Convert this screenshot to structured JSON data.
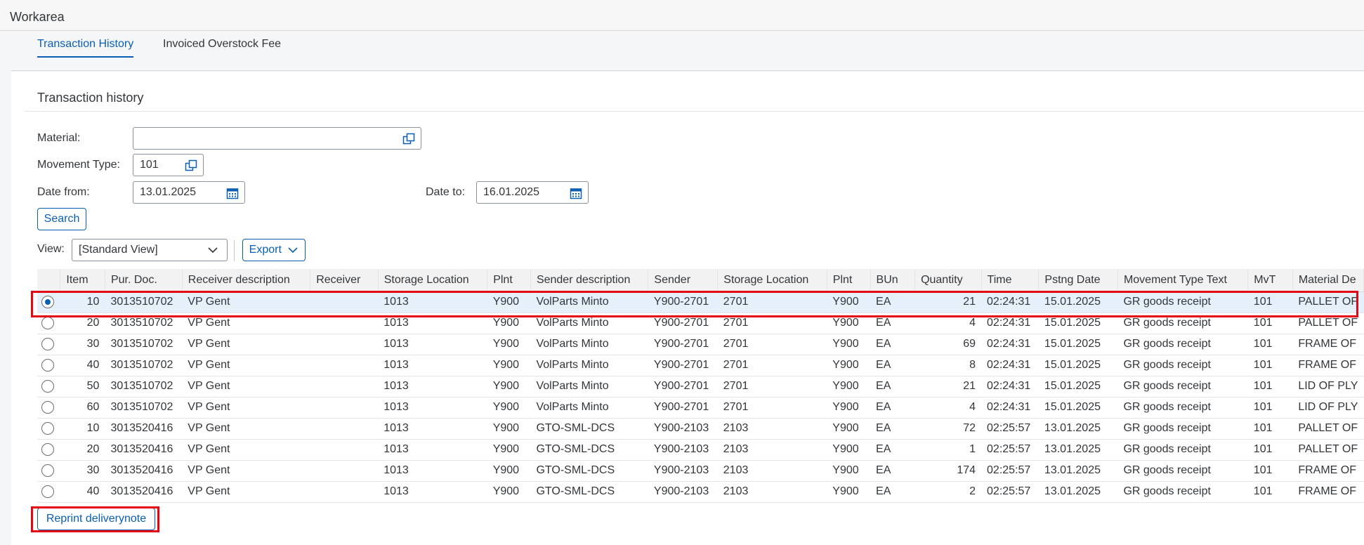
{
  "window": {
    "title": "Workarea"
  },
  "tabs": [
    {
      "label": "Transaction History",
      "active": true
    },
    {
      "label": "Invoiced Overstock Fee",
      "active": false
    }
  ],
  "section": {
    "title": "Transaction history"
  },
  "form": {
    "material": {
      "label": "Material:",
      "value": ""
    },
    "movement_type": {
      "label": "Movement Type:",
      "value": "101"
    },
    "date_from": {
      "label": "Date from:",
      "value": "13.01.2025"
    },
    "date_to": {
      "label": "Date to:",
      "value": "16.01.2025"
    },
    "search_label": "Search"
  },
  "toolbar": {
    "view_label": "View:",
    "view_value": "[Standard View]",
    "export_label": "Export"
  },
  "table": {
    "columns": [
      "Item",
      "Pur. Doc.",
      "Receiver description",
      "Receiver",
      "Storage Location",
      "Plnt",
      "Sender description",
      "Sender",
      "Storage Location",
      "Plnt",
      "BUn",
      "Quantity",
      "Time",
      "Pstng Date",
      "Movement Type Text",
      "MvT",
      "Material De"
    ],
    "rows": [
      [
        "10",
        "3013510702",
        "VP Gent",
        "",
        "1013",
        "Y900",
        "VolParts Minto",
        "Y900-2701",
        "2701",
        "Y900",
        "EA",
        "21",
        "02:24:31",
        "15.01.2025",
        "GR goods receipt",
        "101",
        "PALLET OF"
      ],
      [
        "20",
        "3013510702",
        "VP Gent",
        "",
        "1013",
        "Y900",
        "VolParts Minto",
        "Y900-2701",
        "2701",
        "Y900",
        "EA",
        "4",
        "02:24:31",
        "15.01.2025",
        "GR goods receipt",
        "101",
        "PALLET OF"
      ],
      [
        "30",
        "3013510702",
        "VP Gent",
        "",
        "1013",
        "Y900",
        "VolParts Minto",
        "Y900-2701",
        "2701",
        "Y900",
        "EA",
        "69",
        "02:24:31",
        "15.01.2025",
        "GR goods receipt",
        "101",
        "FRAME OF"
      ],
      [
        "40",
        "3013510702",
        "VP Gent",
        "",
        "1013",
        "Y900",
        "VolParts Minto",
        "Y900-2701",
        "2701",
        "Y900",
        "EA",
        "8",
        "02:24:31",
        "15.01.2025",
        "GR goods receipt",
        "101",
        "FRAME OF"
      ],
      [
        "50",
        "3013510702",
        "VP Gent",
        "",
        "1013",
        "Y900",
        "VolParts Minto",
        "Y900-2701",
        "2701",
        "Y900",
        "EA",
        "21",
        "02:24:31",
        "15.01.2025",
        "GR goods receipt",
        "101",
        "LID OF PLY"
      ],
      [
        "60",
        "3013510702",
        "VP Gent",
        "",
        "1013",
        "Y900",
        "VolParts Minto",
        "Y900-2701",
        "2701",
        "Y900",
        "EA",
        "4",
        "02:24:31",
        "15.01.2025",
        "GR goods receipt",
        "101",
        "LID OF PLY"
      ],
      [
        "10",
        "3013520416",
        "VP Gent",
        "",
        "1013",
        "Y900",
        "GTO-SML-DCS",
        "Y900-2103",
        "2103",
        "Y900",
        "EA",
        "72",
        "02:25:57",
        "13.01.2025",
        "GR goods receipt",
        "101",
        "PALLET OF"
      ],
      [
        "20",
        "3013520416",
        "VP Gent",
        "",
        "1013",
        "Y900",
        "GTO-SML-DCS",
        "Y900-2103",
        "2103",
        "Y900",
        "EA",
        "1",
        "02:25:57",
        "13.01.2025",
        "GR goods receipt",
        "101",
        "PALLET OF"
      ],
      [
        "30",
        "3013520416",
        "VP Gent",
        "",
        "1013",
        "Y900",
        "GTO-SML-DCS",
        "Y900-2103",
        "2103",
        "Y900",
        "EA",
        "174",
        "02:25:57",
        "13.01.2025",
        "GR goods receipt",
        "101",
        "FRAME OF"
      ],
      [
        "40",
        "3013520416",
        "VP Gent",
        "",
        "1013",
        "Y900",
        "GTO-SML-DCS",
        "Y900-2103",
        "2103",
        "Y900",
        "EA",
        "2",
        "02:25:57",
        "13.01.2025",
        "GR goods receipt",
        "101",
        "FRAME OF"
      ]
    ],
    "selected_row": 0
  },
  "footer": {
    "reprint_label": "Reprint deliverynote"
  },
  "colors": {
    "accent": "#0a5fb4",
    "highlight": "#e30613",
    "selected_row": "#e5f0fa"
  },
  "icons": {
    "value_help": "value-help-icon",
    "calendar": "calendar-icon",
    "chevron": "chevron-down-icon"
  }
}
